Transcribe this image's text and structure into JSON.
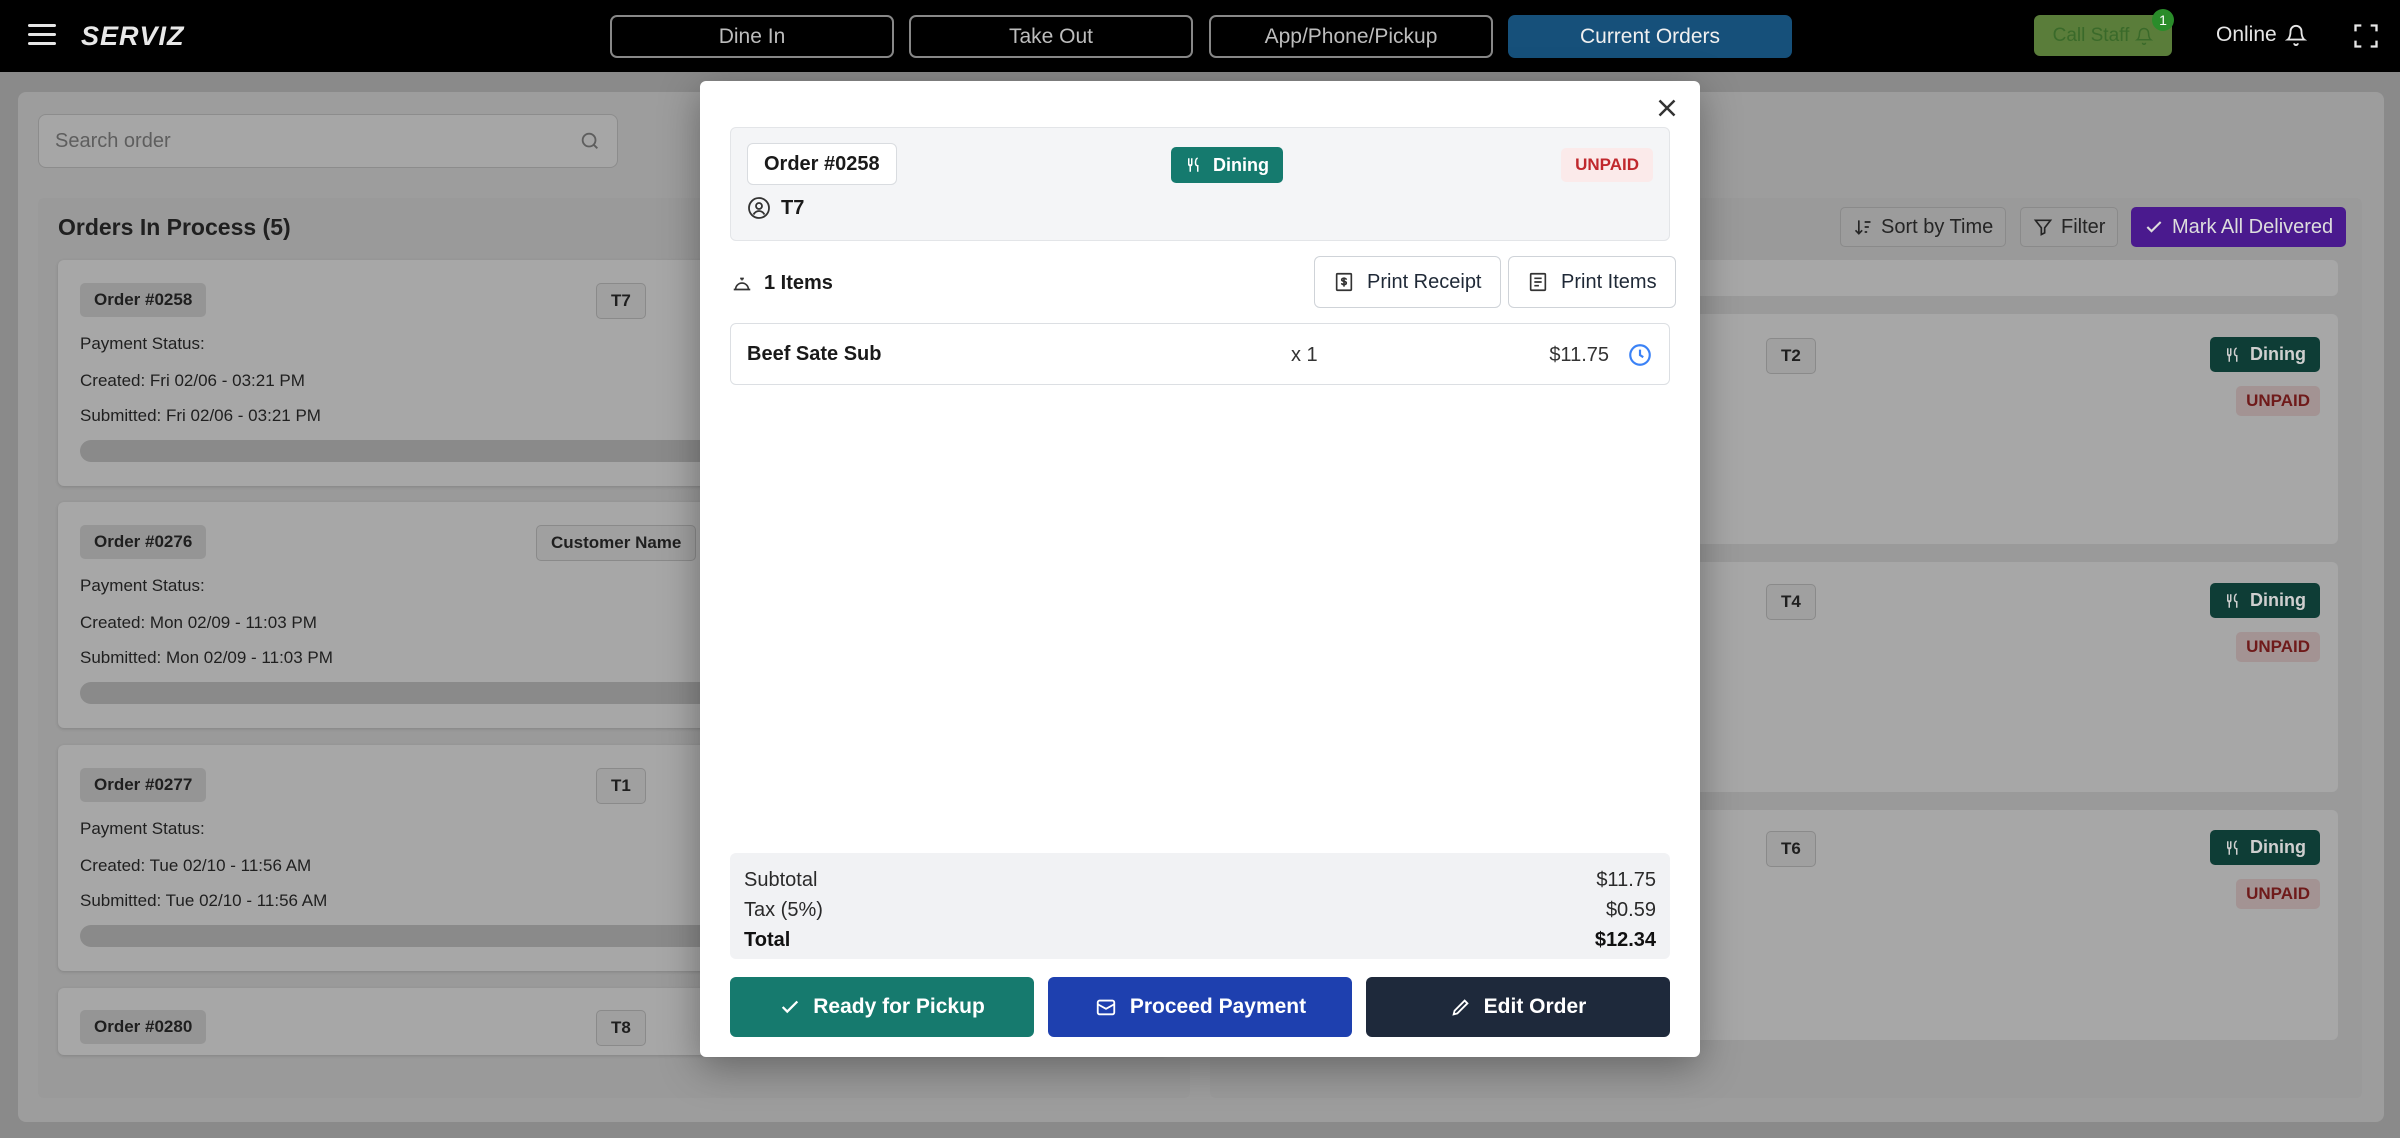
{
  "app": {
    "brand": "SERVIZ"
  },
  "nav": {
    "tabs": [
      {
        "label": "Dine In"
      },
      {
        "label": "Take Out"
      },
      {
        "label": "App/Phone/Pickup"
      },
      {
        "label": "Current Orders"
      }
    ],
    "call_staff": "Call Staff",
    "call_staff_badge": "1",
    "status": "Online"
  },
  "search": {
    "placeholder": "Search order"
  },
  "left_panel": {
    "title": "Orders In Process (5)",
    "orders": [
      {
        "id": "Order #0258",
        "tag": "T7",
        "payment": "Payment Status:",
        "created": "Created: Fri 02/06 - 03:21 PM",
        "submitted": "Submitted: Fri 02/06 - 03:21 PM"
      },
      {
        "id": "Order #0276",
        "tag": "Customer Name",
        "payment": "Payment Status:",
        "created": "Created: Mon 02/09 - 11:03 PM",
        "submitted": "Submitted: Mon 02/09 - 11:03 PM"
      },
      {
        "id": "Order #0277",
        "tag": "T1",
        "payment": "Payment Status:",
        "created": "Created: Tue 02/10 - 11:56 AM",
        "submitted": "Submitted: Tue 02/10 - 11:56 AM"
      },
      {
        "id": "Order #0280",
        "tag": "T8"
      }
    ]
  },
  "right_panel": {
    "sort_label": "Sort by Time",
    "filter_label": "Filter",
    "mark_all_label": "Mark All Delivered",
    "orders": [
      {
        "tag": "T2",
        "type": "Dining",
        "payment": "UNPAID"
      },
      {
        "tag": "T4",
        "type": "Dining",
        "payment": "UNPAID"
      },
      {
        "tag": "T6",
        "type": "Dining",
        "payment": "UNPAID"
      }
    ]
  },
  "modal": {
    "order_id": "Order #0258",
    "order_type": "Dining",
    "payment_status": "UNPAID",
    "table": "T7",
    "items_count": "1 Items",
    "print_receipt": "Print Receipt",
    "print_items": "Print Items",
    "items": [
      {
        "name": "Beef Sate Sub",
        "qty": "x 1",
        "price": "$11.75"
      }
    ],
    "subtotal_label": "Subtotal",
    "subtotal": "$11.75",
    "tax_label": "Tax (5%)",
    "tax": "$0.59",
    "total_label": "Total",
    "total": "$12.34",
    "actions": {
      "ready": "Ready for Pickup",
      "payment": "Proceed Payment",
      "edit": "Edit Order"
    }
  }
}
